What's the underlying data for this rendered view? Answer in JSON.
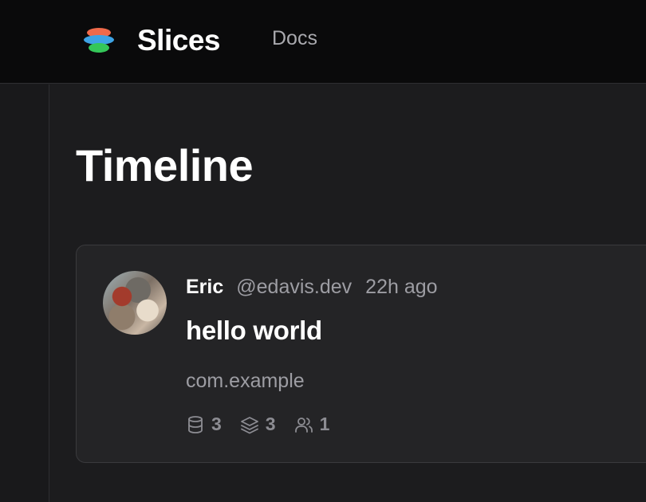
{
  "header": {
    "brand_name": "Slices",
    "nav": [
      {
        "label": "Docs"
      }
    ],
    "logo_colors": [
      "#f06a4a",
      "#3ea3e5",
      "#34c759"
    ]
  },
  "page": {
    "title": "Timeline"
  },
  "timeline": {
    "items": [
      {
        "author_name": "Eric",
        "author_handle": "@edavis.dev",
        "timestamp": "22h ago",
        "title": "hello world",
        "namespace": "com.example",
        "stats": [
          {
            "icon": "database-icon",
            "value": "3"
          },
          {
            "icon": "layers-icon",
            "value": "3"
          },
          {
            "icon": "users-icon",
            "value": "1"
          }
        ]
      }
    ]
  },
  "colors": {
    "background": "#1c1c1e",
    "header_background": "#0a0a0b",
    "card_background": "#242426",
    "muted_text": "#9d9da3"
  }
}
